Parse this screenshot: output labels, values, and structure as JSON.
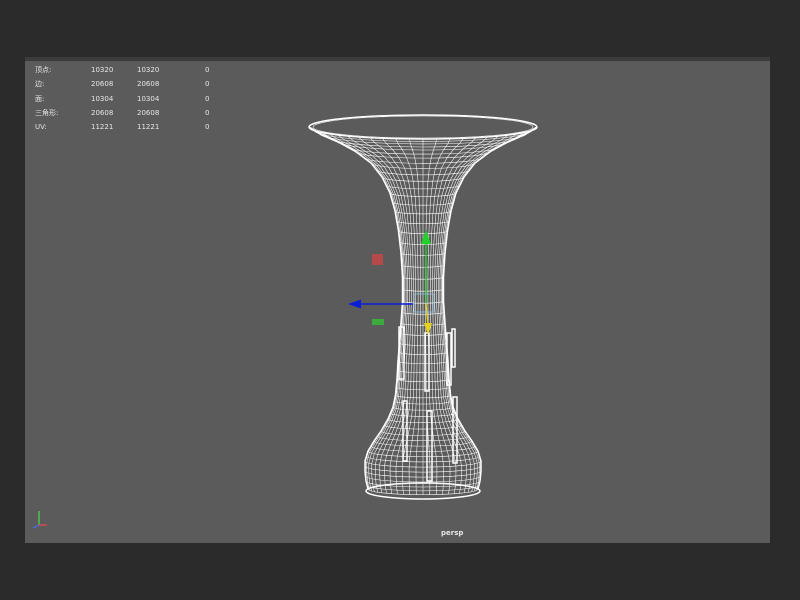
{
  "viewport": {
    "camera": "persp",
    "background_color": "#5b5b5b"
  },
  "stats": {
    "rows": [
      {
        "label": "顶点:",
        "value1": "10320",
        "value2": "10320",
        "value3": "0"
      },
      {
        "label": "边:",
        "value1": "20608",
        "value2": "20608",
        "value3": "0"
      },
      {
        "label": "面:",
        "value1": "10304",
        "value2": "10304",
        "value3": "0"
      },
      {
        "label": "三角形:",
        "value1": "20608",
        "value2": "20608",
        "value3": "0"
      },
      {
        "label": "UV:",
        "value1": "11221",
        "value2": "11221",
        "value3": "0"
      }
    ]
  },
  "manipulator": {
    "x_axis_color": "#0a1fd6",
    "y_axis_color": "#22d12a",
    "z_axis_color": "#e6d21a",
    "handle_red": "#b44a4a",
    "handle_green": "#3caa3c"
  },
  "axis_indicator": {
    "icon": "world-axis-icon",
    "x_color": "#e24a4a",
    "y_color": "#4ad24a",
    "z_color": "#4a6ae2"
  }
}
